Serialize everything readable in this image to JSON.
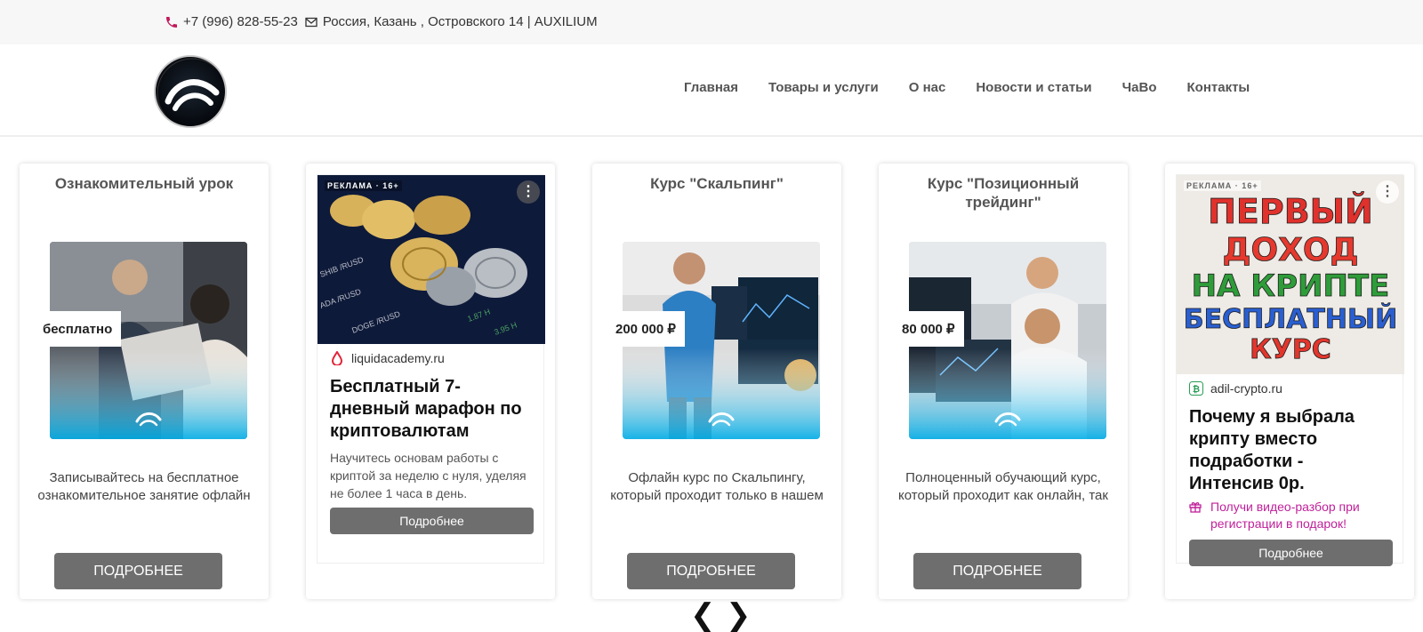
{
  "topbar": {
    "phone": "+7 (996) 828-55-23",
    "address": "Россия, Казань , Островского 14 | AUXILIUM",
    "phone_icon": "phone-icon",
    "mail_icon": "mail-icon"
  },
  "nav": {
    "items": [
      "Главная",
      "Товары и услуги",
      "О нас",
      "Новости и статьи",
      "ЧаВо",
      "Контакты"
    ]
  },
  "cards": [
    {
      "title": "Ознакомительный урок",
      "price": "бесплатно",
      "desc": "Записывайтесь на бесплатное ознакомительное занятие офлайн",
      "button": "ПОДРОБНЕЕ"
    },
    {
      "title": "Курс \"Скальпинг\"",
      "price": "200 000 ₽",
      "desc": "Офлайн курс по Скальпингу, который проходит только в нашем",
      "button": "ПОДРОБНЕЕ"
    },
    {
      "title": "Курс \"Позиционный трейдинг\"",
      "price": "80 000 ₽",
      "desc": "Полноценный обучающий курс, который проходит как онлайн, так",
      "button": "ПОДРОБНЕЕ"
    }
  ],
  "ads": [
    {
      "badge": "РЕКЛАМА · 16+",
      "domain": "liquidacademy.ru",
      "headline": "Бесплатный 7-дневный марафон по криптовалютам",
      "body": "Научитесь основам работы с криптой за неделю с нуля, уделяя не более 1 часа в день.",
      "button": "Подробнее",
      "ticker_labels": [
        "SHIB /RUSD",
        "ADA /RUSD",
        "DOGE /RUSD"
      ]
    },
    {
      "badge": "РЕКЛАМА · 16+",
      "image_text": [
        "ПЕРВЫЙ",
        "ДОХОД",
        "НА КРИПТЕ",
        "БЕСПЛАТНЫЙ",
        "КУРС"
      ],
      "domain": "adil-crypto.ru",
      "headline": "Почему я выбрала крипту вместо подработки - Интенсив 0р.",
      "promo": "Получи видео-разбор при регистрации в подарок!",
      "button": "Подробнее"
    }
  ],
  "colors": {
    "button": "#6e6e6e",
    "promo": "#c0209a",
    "accent_phone": "#c2185b"
  }
}
